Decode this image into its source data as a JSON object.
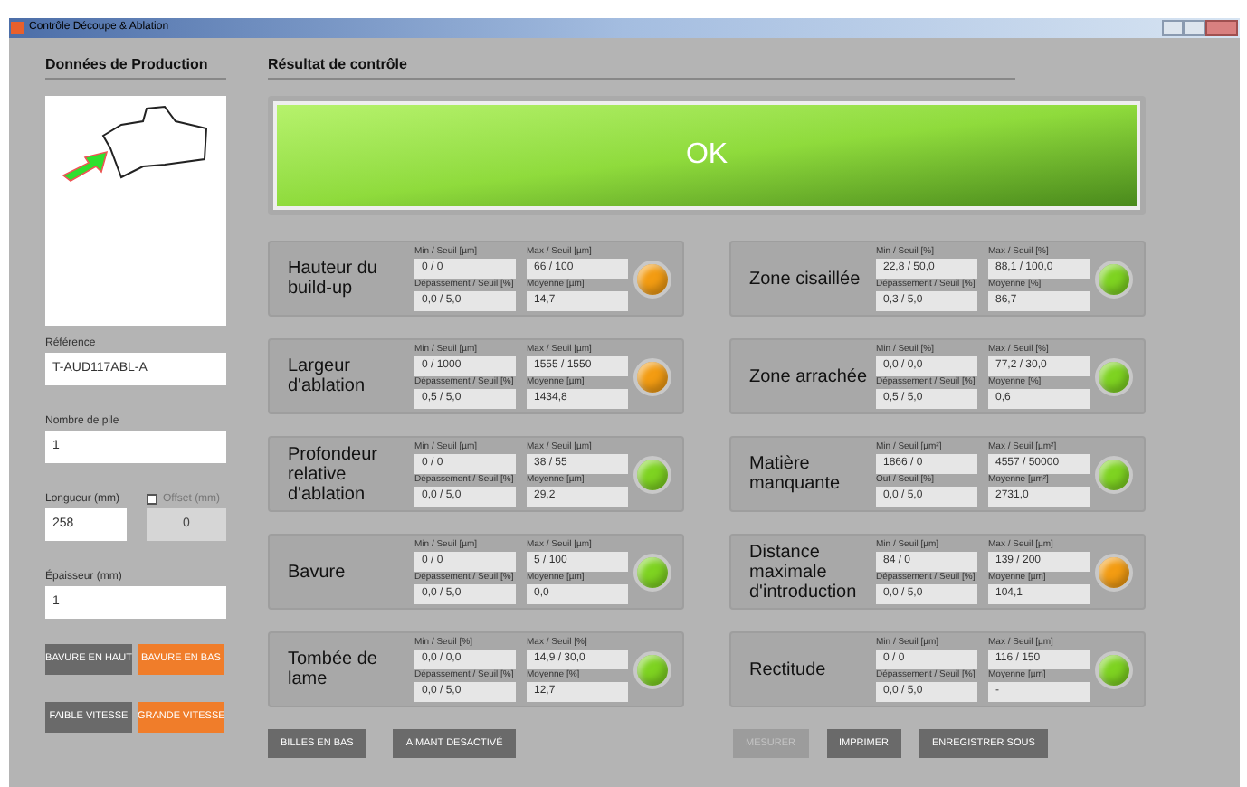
{
  "window": {
    "title": "Contrôle Découpe & Ablation"
  },
  "production": {
    "heading": "Données de Production",
    "reference": {
      "label": "Référence",
      "value": "T-AUD117ABL-A"
    },
    "stack": {
      "label": "Nombre de pile",
      "value": "1"
    },
    "length": {
      "label": "Longueur (mm)",
      "value": "258"
    },
    "offset": {
      "label": "Offset (mm)",
      "value": "0",
      "checked": false
    },
    "thickness": {
      "label": "Épaisseur (mm)",
      "value": "1"
    },
    "burr_toggle": [
      {
        "label": "BAVURE EN HAUT",
        "selected": false
      },
      {
        "label": "BAVURE EN BAS",
        "selected": true
      }
    ],
    "speed_toggle": [
      {
        "label": "FAIBLE VITESSE",
        "selected": false
      },
      {
        "label": "GRANDE VITESSE",
        "selected": true
      }
    ]
  },
  "result": {
    "heading": "Résultat de contrôle",
    "verdict": "OK"
  },
  "measures_left": [
    {
      "name": "Hauteur du build-up",
      "labels": [
        "Min / Seuil [µm]",
        "Max / Seuil [µm]",
        "Dépassement / Seuil [%]",
        "Moyenne [µm]"
      ],
      "values": [
        "0 / 0",
        "66 / 100",
        "0,0 / 5,0",
        "14,7"
      ],
      "color": "#f39c12"
    },
    {
      "name": "Largeur d'ablation",
      "labels": [
        "Min / Seuil [µm]",
        "Max / Seuil [µm]",
        "Dépassement / Seuil [%]",
        "Moyenne [µm]"
      ],
      "values": [
        "0 / 1000",
        "1555 / 1550",
        "0,5 / 5,0",
        "1434,8"
      ],
      "color": "#f39c12"
    },
    {
      "name": "Profondeur relative d'ablation",
      "labels": [
        "Min / Seuil [µm]",
        "Max / Seuil [µm]",
        "Dépassement / Seuil [%]",
        "Moyenne [µm]"
      ],
      "values": [
        "0 / 0",
        "38 / 55",
        "0,0 / 5,0",
        "29,2"
      ],
      "color": "#7ed321"
    },
    {
      "name": "Bavure",
      "labels": [
        "Min / Seuil [µm]",
        "Max / Seuil [µm]",
        "Dépassement / Seuil [%]",
        "Moyenne [µm]"
      ],
      "values": [
        "0 / 0",
        "5 / 100",
        "0,0 / 5,0",
        "0,0"
      ],
      "color": "#7ed321"
    },
    {
      "name": "Tombée de lame",
      "labels": [
        "Min / Seuil [%]",
        "Max / Seuil [%]",
        "Dépassement / Seuil [%]",
        "Moyenne [%]"
      ],
      "values": [
        "0,0 / 0,0",
        "14,9 / 30,0",
        "0,0 / 5,0",
        "12,7"
      ],
      "color": "#7ed321"
    }
  ],
  "measures_right": [
    {
      "name": "Zone cisaillée",
      "labels": [
        "Min / Seuil [%]",
        "Max / Seuil [%]",
        "Dépassement / Seuil [%]",
        "Moyenne [%]"
      ],
      "values": [
        "22,8 / 50,0",
        "88,1 / 100,0",
        "0,3 / 5,0",
        "86,7"
      ],
      "color": "#7ed321"
    },
    {
      "name": "Zone arrachée",
      "labels": [
        "Min / Seuil [%]",
        "Max / Seuil [%]",
        "Dépassement / Seuil [%]",
        "Moyenne [%]"
      ],
      "values": [
        "0,0 / 0,0",
        "77,2 / 30,0",
        "0,5 / 5,0",
        "0,6"
      ],
      "color": "#7ed321"
    },
    {
      "name": "Matière manquante",
      "labels": [
        "Min / Seuil [µm²]",
        "Max / Seuil [µm²]",
        "Out / Seuil [%]",
        "Moyenne [µm²]"
      ],
      "values": [
        "1866 / 0",
        "4557 / 50000",
        "0,0 / 5,0",
        "2731,0"
      ],
      "color": "#7ed321"
    },
    {
      "name": "Distance maximale d'introduction",
      "labels": [
        "Min / Seuil [µm]",
        "Max / Seuil [µm]",
        "Dépassement / Seuil [%]",
        "Moyenne [µm]"
      ],
      "values": [
        "84 / 0",
        "139 / 200",
        "0,0 / 5,0",
        "104,1"
      ],
      "color": "#f39c12"
    },
    {
      "name": "Rectitude",
      "labels": [
        "Min / Seuil [µm]",
        "Max / Seuil [µm]",
        "Dépassement / Seuil [%]",
        "Moyenne [µm]"
      ],
      "values": [
        "0 / 0",
        "116 / 150",
        "0,0 / 5,0",
        "-"
      ],
      "color": "#7ed321"
    }
  ],
  "buttons_left": [
    {
      "label": "BILLES EN BAS",
      "disabled": false
    },
    {
      "label": "AIMANT DESACTIVÉ",
      "disabled": false
    }
  ],
  "buttons_right": [
    {
      "label": "MESURER",
      "disabled": true
    },
    {
      "label": "IMPRIMER",
      "disabled": false
    },
    {
      "label": "ENREGISTRER SOUS",
      "disabled": false
    }
  ]
}
